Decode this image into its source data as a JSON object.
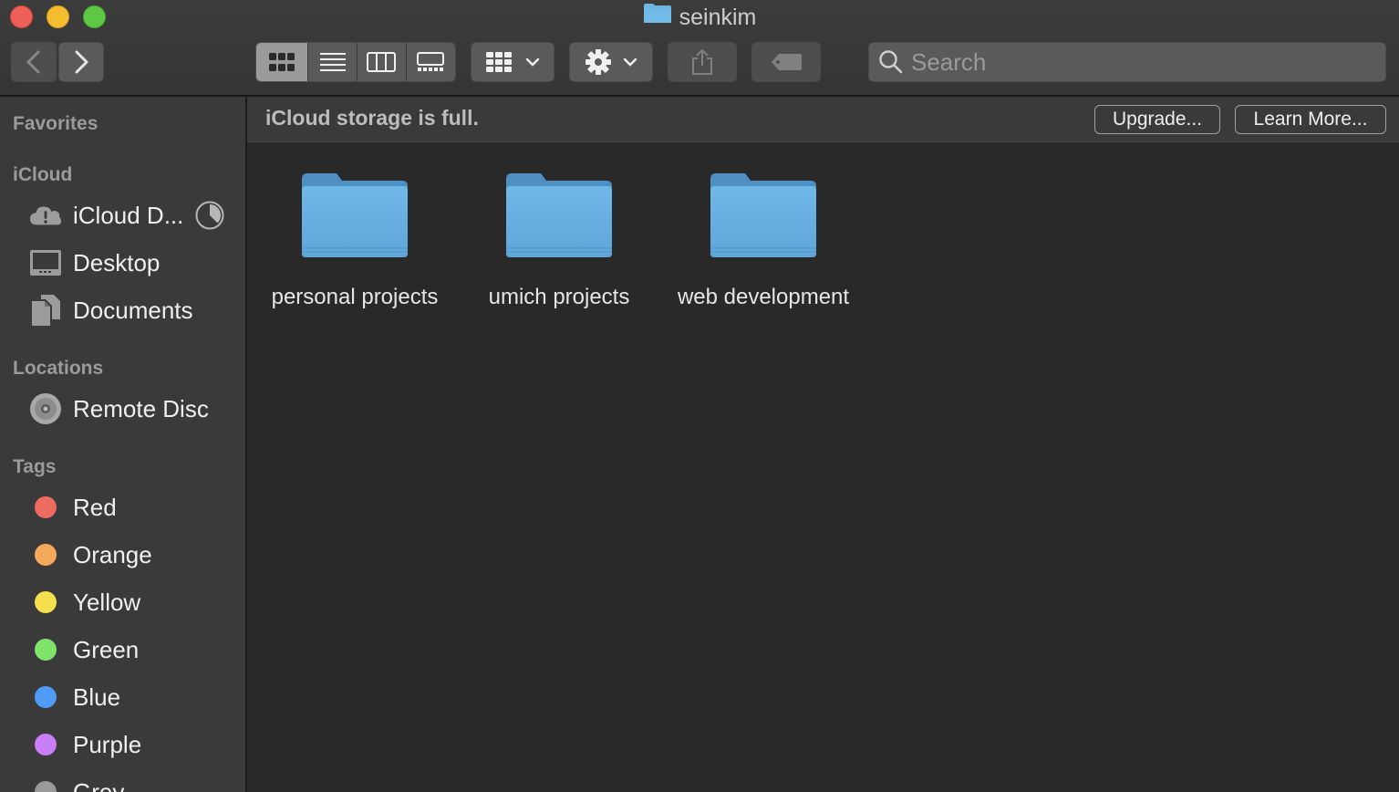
{
  "window": {
    "title": "seinkim"
  },
  "toolbar": {
    "search_placeholder": "Search"
  },
  "sidebar": {
    "sections": {
      "favorites": "Favorites",
      "icloud": "iCloud",
      "locations": "Locations",
      "tags": "Tags"
    },
    "icloud_items": [
      {
        "label": "iCloud D...",
        "icon": "icloud-drive-warning-icon"
      },
      {
        "label": "Desktop",
        "icon": "desktop-icon"
      },
      {
        "label": "Documents",
        "icon": "documents-icon"
      }
    ],
    "location_items": [
      {
        "label": "Remote Disc",
        "icon": "disc-icon"
      }
    ],
    "tags": [
      {
        "label": "Red",
        "color": "#ee6b60"
      },
      {
        "label": "Orange",
        "color": "#f4a95b"
      },
      {
        "label": "Yellow",
        "color": "#f5e04f"
      },
      {
        "label": "Green",
        "color": "#7ee46a"
      },
      {
        "label": "Blue",
        "color": "#4f9bf5"
      },
      {
        "label": "Purple",
        "color": "#c97ef5"
      },
      {
        "label": "Grey",
        "color": "#9a9a9a"
      }
    ]
  },
  "banner": {
    "message": "iCloud storage is full.",
    "upgrade_label": "Upgrade...",
    "learn_more_label": "Learn More..."
  },
  "folders": [
    {
      "name": "personal projects"
    },
    {
      "name": "umich projects"
    },
    {
      "name": "web development"
    }
  ],
  "colors": {
    "folder_blue": "#6cb4e4",
    "accent_traffic_close": "#ee5f57",
    "accent_traffic_min": "#f4bd30",
    "accent_traffic_max": "#5ec744"
  }
}
